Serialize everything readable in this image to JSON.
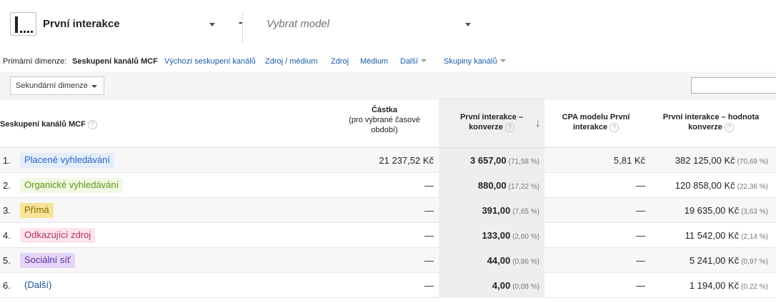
{
  "model": {
    "selected": "První interakce",
    "separator": "-",
    "compare_placeholder": "Vybrat model"
  },
  "primary_dimension": {
    "label": "Primární dimenze:",
    "active": "Seskupení kanálů MCF",
    "links": [
      "Výchozí seskupení kanálů",
      "Zdroj / médium",
      "Zdroj",
      "Médium",
      "Další",
      "Skupiny kanálů"
    ]
  },
  "secondary_dimension": {
    "button_label": "Sekundární dimenze",
    "search_value": ""
  },
  "table": {
    "headers": {
      "dimension": "Seskupení kanálů MCF",
      "amount_title": "Částka",
      "amount_sub": "(pro vybrané časové období)",
      "first_interaction": "První interakce – konverze",
      "cpa": "CPA modelu První interakce",
      "value": "První interakce – hodnota konverze"
    },
    "help_glyph": "?",
    "sort_glyph": "↓",
    "rows": [
      {
        "index": "1.",
        "channel": "Placené vyhledávání",
        "chip_bg": "#e3edfb",
        "chip_fg": "#2a64c5",
        "amount": "21 237,52 Kč",
        "conv": "3 657,00",
        "conv_pct": "(71,58 %)",
        "cpa": "5,81 Kč",
        "value": "382 125,00 Kč",
        "value_pct": "(70,69 %)"
      },
      {
        "index": "2.",
        "channel": "Organické vyhledávání",
        "chip_bg": "#f1f8e4",
        "chip_fg": "#5a9a12",
        "amount": "—",
        "conv": "880,00",
        "conv_pct": "(17,22 %)",
        "cpa": "—",
        "value": "120 858,00 Kč",
        "value_pct": "(22,36 %)"
      },
      {
        "index": "3.",
        "channel": "Přímá",
        "chip_bg": "#f7e49a",
        "chip_fg": "#8a6a00",
        "amount": "—",
        "conv": "391,00",
        "conv_pct": "(7,65 %)",
        "cpa": "—",
        "value": "19 635,00 Kč",
        "value_pct": "(3,63 %)"
      },
      {
        "index": "4.",
        "channel": "Odkazující zdroj",
        "chip_bg": "#fde4ee",
        "chip_fg": "#b0325a",
        "amount": "—",
        "conv": "133,00",
        "conv_pct": "(2,60 %)",
        "cpa": "—",
        "value": "11 542,00 Kč",
        "value_pct": "(2,14 %)"
      },
      {
        "index": "5.",
        "channel": "Sociální síť",
        "chip_bg": "#e4d6f8",
        "chip_fg": "#5c2fa0",
        "amount": "—",
        "conv": "44,00",
        "conv_pct": "(0,86 %)",
        "cpa": "—",
        "value": "5 241,00 Kč",
        "value_pct": "(0,97 %)"
      },
      {
        "index": "6.",
        "channel": "(Další)",
        "chip_bg": "transparent",
        "chip_fg": "#1a4f8c",
        "amount": "—",
        "conv": "4,00",
        "conv_pct": "(0,08 %)",
        "cpa": "—",
        "value": "1 194,00 Kč",
        "value_pct": "(0,22 %)"
      }
    ]
  }
}
